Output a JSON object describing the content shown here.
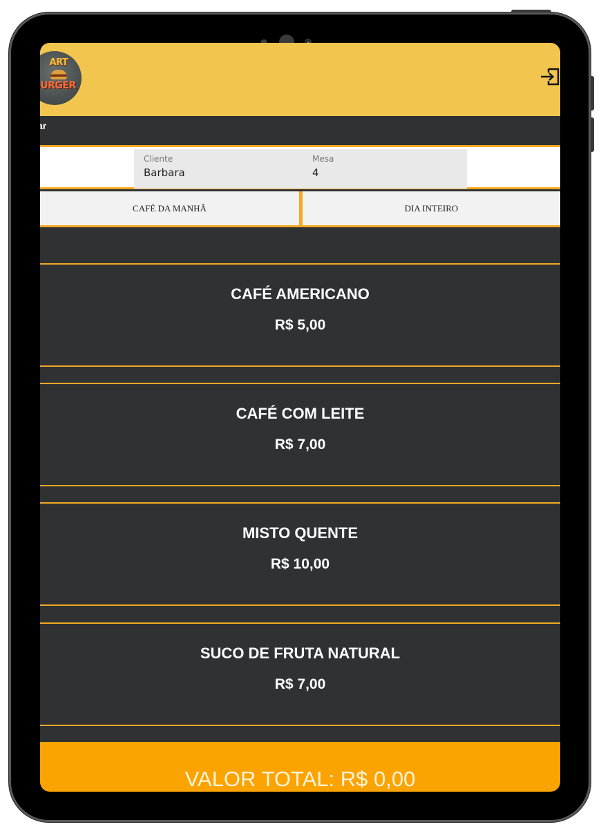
{
  "header": {
    "logo_top": "ART",
    "logo_bottom": "BURGER",
    "exit_icon": "exit-icon"
  },
  "subbar": {
    "text": "ar"
  },
  "form": {
    "client_label": "Cliente",
    "client_value": "Barbara",
    "table_label": "Mesa",
    "table_value": "4"
  },
  "tabs": [
    {
      "label": "CAFÉ DA MANHÃ"
    },
    {
      "label": "DIA INTEIRO"
    }
  ],
  "menu": [
    {
      "name": "CAFÉ AMERICANO",
      "price": "R$ 5,00"
    },
    {
      "name": "CAFÉ COM LEITE",
      "price": "R$ 7,00"
    },
    {
      "name": "MISTO QUENTE",
      "price": "R$ 10,00"
    },
    {
      "name": "SUCO DE FRUTA NATURAL",
      "price": "R$ 7,00"
    }
  ],
  "footer": {
    "total": "VALOR TOTAL: R$ 0,00"
  },
  "colors": {
    "header": "#f1c54e",
    "background": "#2f3133",
    "accent": "#f4a922",
    "footer": "#fba300"
  }
}
